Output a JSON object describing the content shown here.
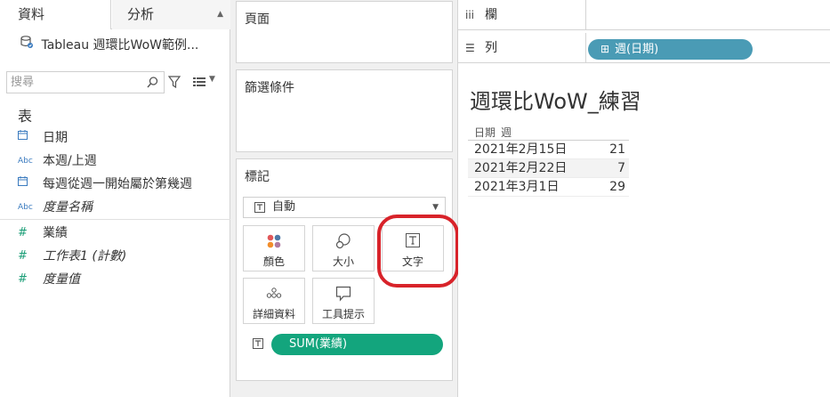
{
  "left_pane": {
    "tabs": [
      "資料",
      "分析"
    ],
    "datasource": "Tableau 週環比WoW範例...",
    "search_placeholder": "搜尋",
    "table_heading": "表",
    "dimensions": [
      {
        "type": "date",
        "icon": "calendar-icon",
        "label": "日期"
      },
      {
        "type": "string",
        "icon": "Abc",
        "label": "本週/上週"
      },
      {
        "type": "date",
        "icon": "calendar-icon",
        "label": "每週從週一開始屬於第幾週"
      },
      {
        "type": "string",
        "icon": "Abc",
        "label": "度量名稱"
      }
    ],
    "measures": [
      {
        "icon": "#",
        "label": "業績"
      },
      {
        "icon": "#",
        "label": "工作表1 (計數)"
      },
      {
        "icon": "#",
        "label": "度量值"
      }
    ]
  },
  "middle_pane": {
    "pages_title": "頁面",
    "filters_title": "篩選條件",
    "marks": {
      "title": "標記",
      "mark_type": "自動",
      "buttons": [
        {
          "label": "顏色",
          "icon": "color-dots-icon"
        },
        {
          "label": "大小",
          "icon": "size-circles-icon"
        },
        {
          "label": "文字",
          "icon": "text-icon",
          "highlighted": true
        },
        {
          "label": "詳細資料",
          "icon": "detail-dots-icon"
        },
        {
          "label": "工具提示",
          "icon": "tooltip-icon"
        }
      ],
      "pill": "SUM(業績)"
    }
  },
  "right_pane": {
    "columns_label": "欄",
    "rows_label": "列",
    "rows_pill": "週(日期)",
    "sheet_title": "週環比WoW_練習",
    "crosstab_headers": [
      "日期",
      "週"
    ],
    "rows": [
      {
        "date": "2021年2月15日",
        "value": "21"
      },
      {
        "date": "2021年2月22日",
        "value": "7"
      },
      {
        "date": "2021年3月1日",
        "value": "29"
      }
    ]
  },
  "colors": {
    "green_pill": "#13a57d",
    "blue_pill": "#4a9bb5",
    "highlight_ring": "#d8232a",
    "calendar_blue": "#3b7bbf"
  }
}
